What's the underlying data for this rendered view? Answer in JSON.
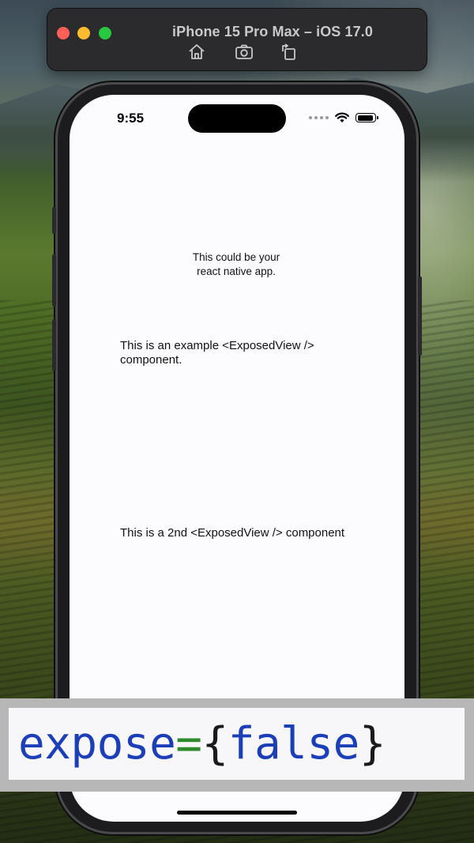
{
  "simulator": {
    "title": "iPhone 15 Pro Max – iOS 17.0",
    "toolbar": [
      {
        "icon": "home-icon"
      },
      {
        "icon": "screenshot-icon"
      },
      {
        "icon": "rotate-icon"
      }
    ]
  },
  "status_bar": {
    "time": "9:55",
    "icons": [
      "cellular-dots-icon",
      "wifi-icon",
      "battery-icon"
    ]
  },
  "app": {
    "intro_text": "This could be your react native app.",
    "exposed_view_1": "This is an example <ExposedView /> component.",
    "exposed_view_2": "This is a 2nd <ExposedView /> component"
  },
  "code_overlay": {
    "prop": "expose",
    "equals": "=",
    "open_brace": "{",
    "value": "false",
    "close_brace": "}"
  },
  "colors": {
    "code_prop": "#1c3fb7",
    "code_equals": "#2d8a2d",
    "code_value": "#1c3fb7",
    "screen_bg": "#fcfcfe"
  }
}
